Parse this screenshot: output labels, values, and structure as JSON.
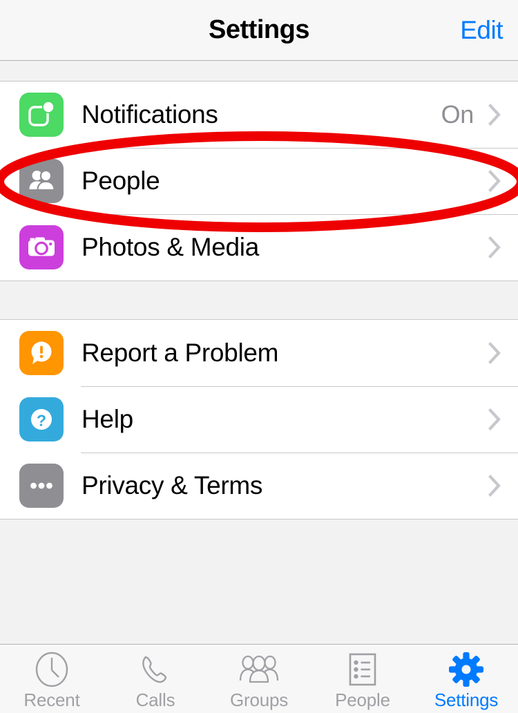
{
  "navbar": {
    "title": "Settings",
    "edit_label": "Edit",
    "edit_color": "#007aff"
  },
  "groups": [
    {
      "id": "group-1",
      "rows": [
        {
          "label": "Notifications",
          "value": "On",
          "icon": "notifications-badge-icon",
          "icon_color": "#4cd964",
          "accessory": "chevron-right-icon"
        },
        {
          "label": "People",
          "value": "",
          "icon": "people-group-icon",
          "icon_color": "#8e8e93",
          "accessory": "chevron-right-icon"
        },
        {
          "label": "Photos & Media",
          "value": "",
          "icon": "camera-icon",
          "icon_color": "#cc3fdc",
          "accessory": "chevron-right-icon"
        }
      ]
    },
    {
      "id": "group-2",
      "rows": [
        {
          "label": "Report a Problem",
          "value": "",
          "icon": "exclamation-bubble-icon",
          "icon_color": "#ff9500",
          "accessory": "chevron-right-icon"
        },
        {
          "label": "Help",
          "value": "",
          "icon": "question-mark-icon",
          "icon_color": "#34aadc",
          "accessory": "chevron-right-icon"
        },
        {
          "label": "Privacy & Terms",
          "value": "",
          "icon": "ellipsis-icon",
          "icon_color": "#8e8e93",
          "accessory": "chevron-right-icon"
        }
      ]
    }
  ],
  "tabbar": {
    "tabs": [
      {
        "label": "Recent",
        "icon": "clock-icon",
        "active": false
      },
      {
        "label": "Calls",
        "icon": "phone-icon",
        "active": false
      },
      {
        "label": "Groups",
        "icon": "groups-icon",
        "active": false
      },
      {
        "label": "People",
        "icon": "list-page-icon",
        "active": false
      },
      {
        "label": "Settings",
        "icon": "gear-icon",
        "active": true
      }
    ],
    "active_color": "#007aff",
    "inactive_color": "#a0a0a5"
  },
  "annotation": {
    "shape": "ellipse",
    "color": "#ee0000",
    "targets": "People",
    "stroke_width": 14
  }
}
